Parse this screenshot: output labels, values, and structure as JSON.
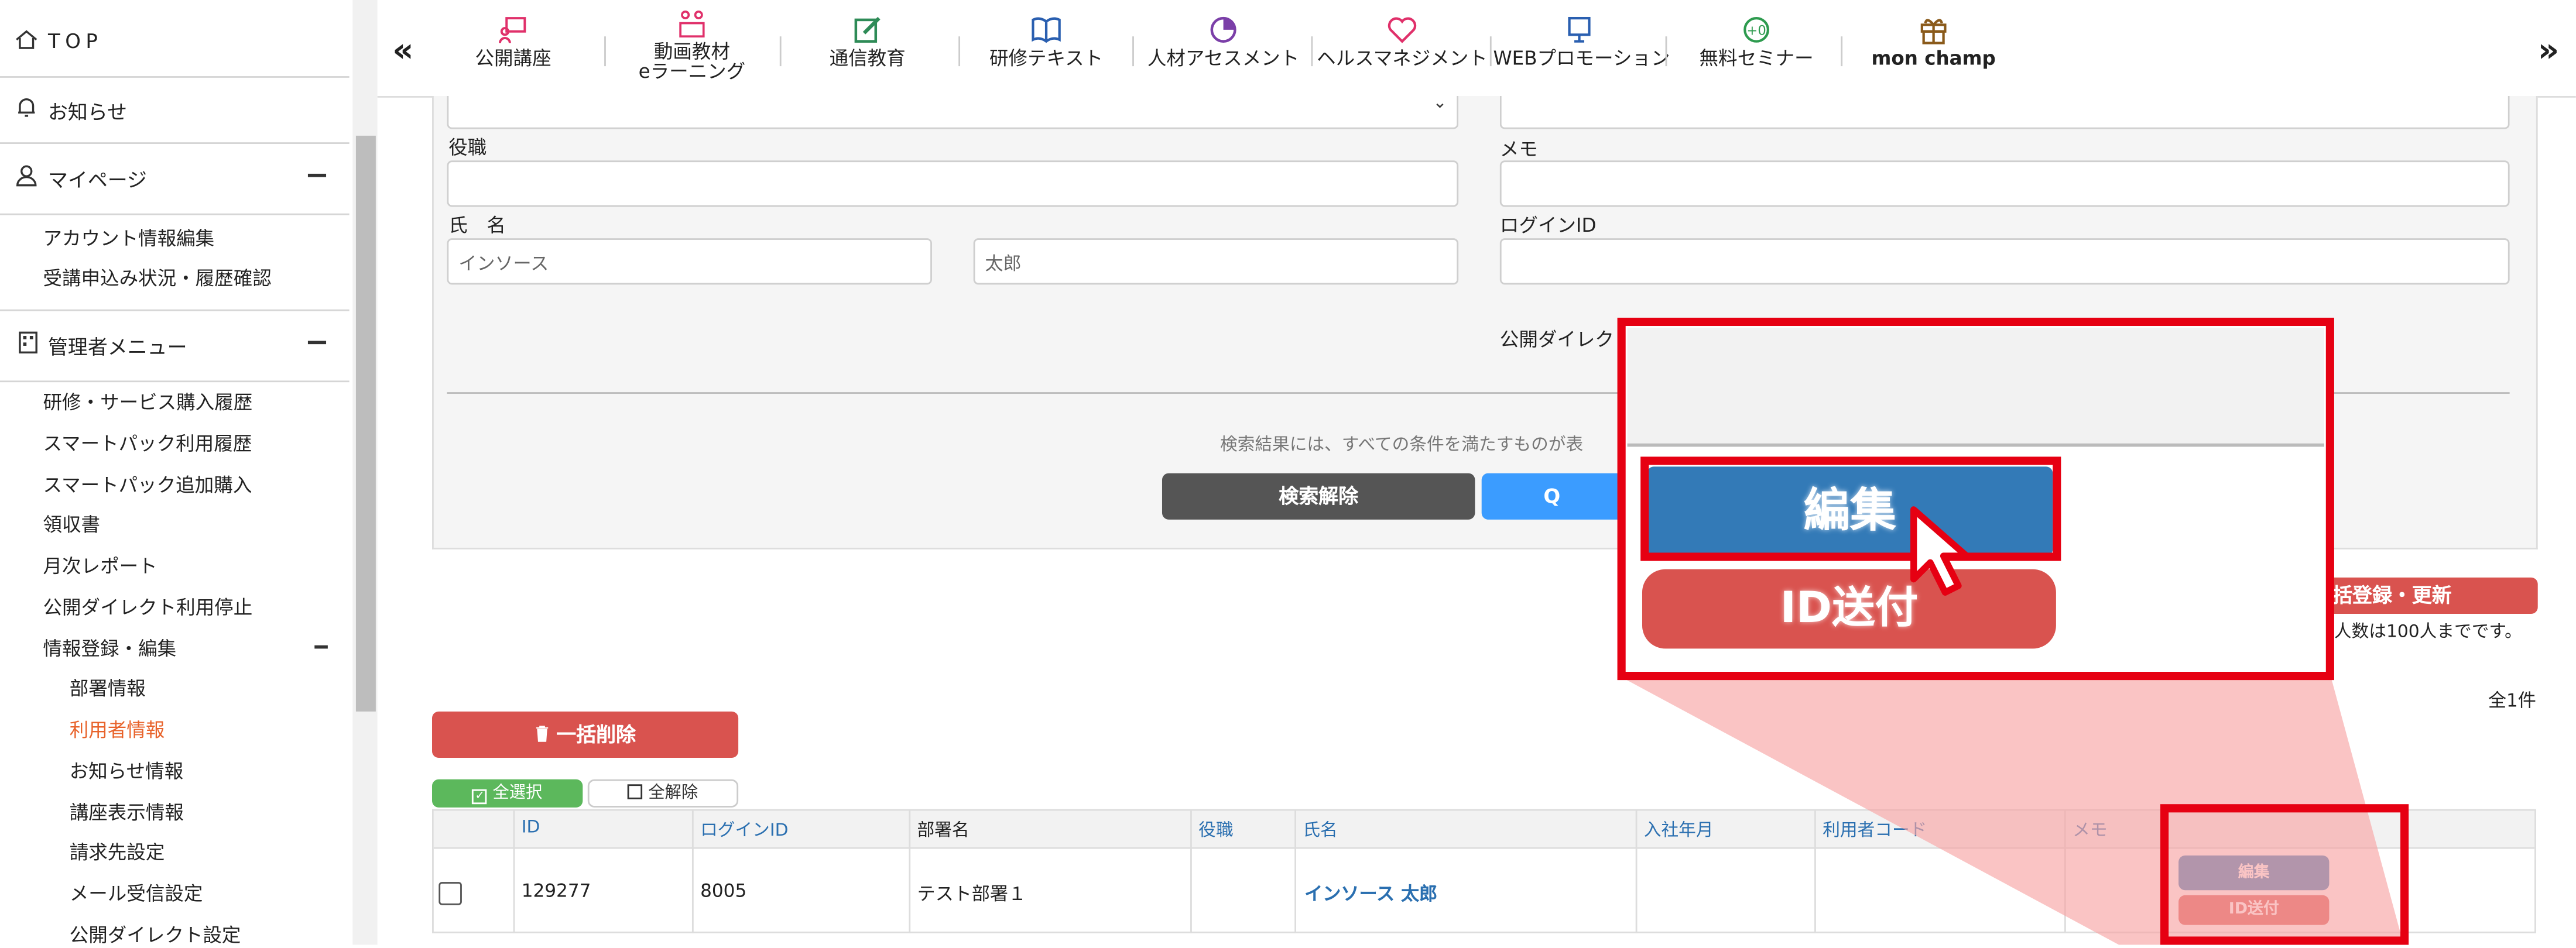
{
  "sidebar": {
    "top_label": "TOP",
    "news_label": "お知らせ",
    "mypage_label": "マイページ",
    "mypage_items": [
      "アカウント情報編集",
      "受講申込み状況・履歴確認"
    ],
    "admin_label": "管理者メニュー",
    "admin_items": [
      "研修・サービス購入履歴",
      "スマートパック利用履歴",
      "スマートパック追加購入",
      "領収書",
      "月次レポート",
      "公開ダイレクト利用停止",
      "情報登録・編集"
    ],
    "sub_items": [
      "部署情報",
      "利用者情報",
      "お知らせ情報",
      "講座表示情報",
      "請求先設定",
      "メール受信設定",
      "公開ダイレクト設定"
    ],
    "active_sub": "利用者情報",
    "active_color": "#e8632b"
  },
  "topnav": {
    "left_chevron": "«",
    "right_chevron": "»",
    "items": [
      {
        "label": "公開講座",
        "icon": "presentation-icon",
        "color": "#e0306a"
      },
      {
        "label": "動画教材\neラーニング",
        "icon": "people-screen-icon",
        "color": "#e0306a"
      },
      {
        "label": "通信教育",
        "icon": "edit-note-icon",
        "color": "#2e8b57"
      },
      {
        "label": "研修テキスト",
        "icon": "book-icon",
        "color": "#2a5fb0"
      },
      {
        "label": "人材アセスメント",
        "icon": "pie-chart-icon",
        "color": "#7b3fa8"
      },
      {
        "label": "ヘルスマネジメント",
        "icon": "heart-icon",
        "color": "#e0306a"
      },
      {
        "label": "WEBプロモーション",
        "icon": "monitor-icon",
        "color": "#2a5fb0"
      },
      {
        "label": "無料セミナー",
        "icon": "zero-coin-icon",
        "color": "#2e9b4f"
      },
      {
        "label": "mon champ",
        "icon": "gift-icon",
        "color": "#8a5a1a"
      }
    ]
  },
  "form": {
    "position_label": "役職",
    "name_label": "氏　名",
    "last_name_placeholder": "インソース",
    "first_name_placeholder": "太郎",
    "memo_label": "メモ",
    "login_id_label": "ログインID",
    "public_direct_label": "公開ダイレク",
    "search_note": "検索結果には、すべての条件を満たすものが表",
    "clear_button": "検索解除",
    "search_button_partial": "Q"
  },
  "actions": {
    "bulk_register": "括登録・更新",
    "limit_note": "人数は100人までです。",
    "count": "全1件",
    "bulk_delete": "一括削除",
    "select_all": "全選択",
    "deselect_all": "全解除"
  },
  "table": {
    "headers": [
      "ID",
      "ログインID",
      "部署名",
      "役職",
      "氏名",
      "入社年月",
      "利用者コード",
      "メモ"
    ],
    "rows": [
      {
        "id": "129277",
        "login_id": "8005",
        "dept": "テスト部署１",
        "position": "",
        "name": "インソース 太郎",
        "joined": "",
        "user_code": "",
        "memo": ""
      }
    ],
    "edit_label": "編集",
    "send_id_label": "ID送付"
  },
  "zoom": {
    "edit_label": "編集",
    "send_id_label": "ID送付"
  },
  "colors": {
    "edit_blue": "#337ab7",
    "send_red": "#d9534f",
    "highlight_red": "#e60012",
    "dark_button": "#555555",
    "search_button": "#3b9cff",
    "green_select": "#5cb85c"
  }
}
